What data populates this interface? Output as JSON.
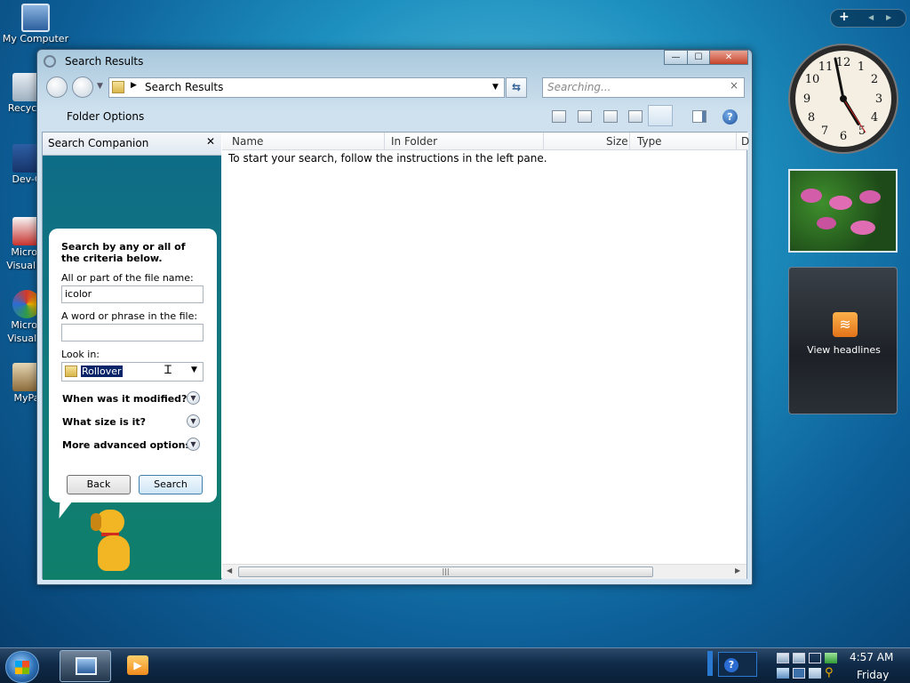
{
  "desktop": {
    "icons": [
      {
        "label": "My Computer"
      },
      {
        "label": "Recycle"
      },
      {
        "label": "Dev-C"
      },
      {
        "label": "Micros\nVisual #"
      },
      {
        "label": "Micros\nVisual S"
      },
      {
        "label": "MyPa"
      }
    ]
  },
  "window": {
    "title": "Search Results",
    "controls": {
      "minimize": "—",
      "maximize": "☐",
      "close": "✕"
    },
    "address": {
      "path": "Search Results"
    },
    "search": {
      "placeholder": "Searching...",
      "clear": "×"
    },
    "command_bar": {
      "folder_options": "Folder Options"
    },
    "left_pane": {
      "header": "Search Companion",
      "close": "✕",
      "prompt": "Search by any or all of the criteria below.",
      "filename_label": "All or part of the file name:",
      "filename_value": "icolor",
      "phrase_label": "A word or phrase in the file:",
      "phrase_value": "",
      "lookin_label": "Look in:",
      "lookin_value": "Rollover",
      "advanced": [
        {
          "label": "When was it modified?"
        },
        {
          "label": "What size is it?"
        },
        {
          "label": "More advanced options"
        }
      ],
      "back_button": "Back",
      "search_button": "Search"
    },
    "columns": [
      "Name",
      "In Folder",
      "Size",
      "Type",
      "D"
    ],
    "empty_message": "To start your search, follow the instructions in the left pane."
  },
  "gadgets": {
    "feed": {
      "label": "View headlines"
    }
  },
  "taskbar": {
    "clock_time": "4:57 AM",
    "clock_day": "Friday"
  },
  "colors": {
    "accent": "#0d5f98",
    "selection": "#0a246a",
    "sidebar_teal": "#127a7c"
  }
}
